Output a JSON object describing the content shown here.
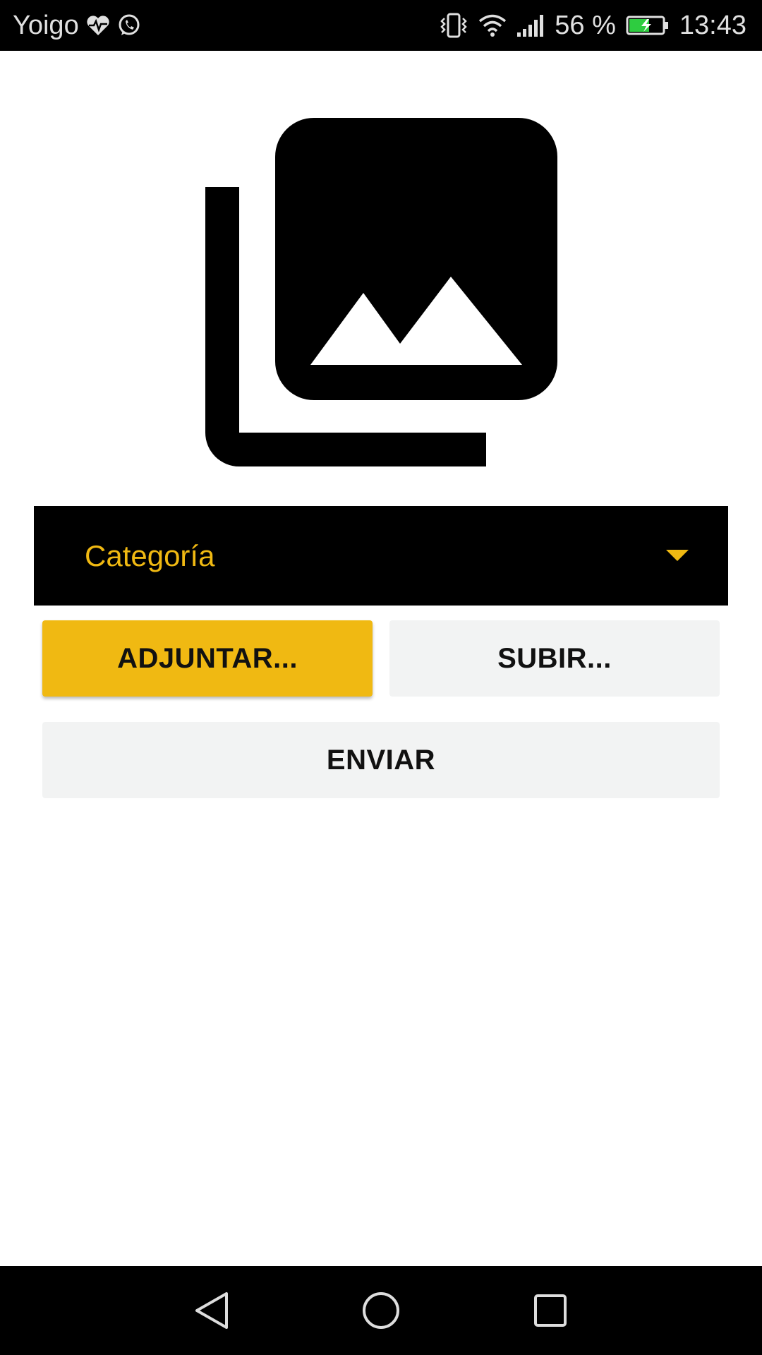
{
  "status_bar": {
    "carrier": "Yoigo",
    "battery_percent": "56 %",
    "time": "13:43",
    "icons": [
      "heart-pulse-icon",
      "whatsapp-icon",
      "vibrate-icon",
      "wifi-icon",
      "signal-icon",
      "battery-charging-icon"
    ]
  },
  "main": {
    "illustration_icon": "photo-library-icon",
    "category": {
      "label": "Categoría",
      "icon": "dropdown-arrow-icon"
    },
    "buttons": {
      "attach_label": "ADJUNTAR...",
      "upload_label": "SUBIR...",
      "send_label": "ENVIAR"
    }
  },
  "nav_bar": {
    "icons": [
      "back-icon",
      "home-icon",
      "recents-icon"
    ]
  },
  "colors": {
    "accent": "#f0b912",
    "secondary_button": "#f2f3f3",
    "bars": "#000000",
    "battery_fill": "#2ecc40"
  }
}
